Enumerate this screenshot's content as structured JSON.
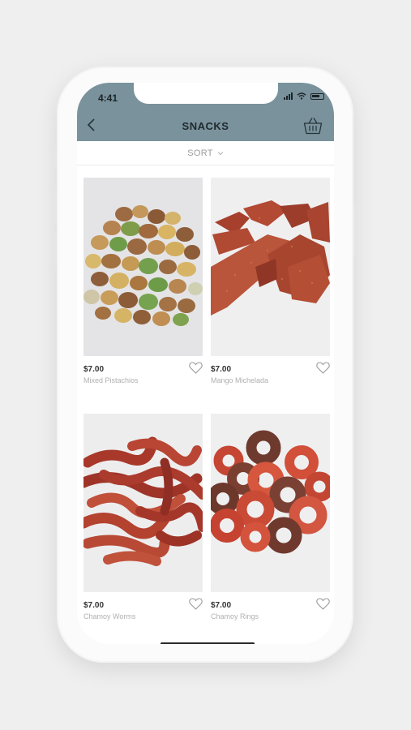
{
  "status_bar": {
    "time": "4:41"
  },
  "header": {
    "title": "SNACKS",
    "back_icon": "chevron-left-icon",
    "cart_icon": "basket-icon",
    "background": "#7a929c"
  },
  "sort": {
    "label": "SORT"
  },
  "products": [
    {
      "price": "$7.00",
      "name": "Mixed Pistachios",
      "image": "pistachios-image"
    },
    {
      "price": "$7.00",
      "name": "Mango Michelada",
      "image": "mango-michelada-image"
    },
    {
      "price": "$7.00",
      "name": "Chamoy Worms",
      "image": "chamoy-worms-image"
    },
    {
      "price": "$7.00",
      "name": "Chamoy Rings",
      "image": "chamoy-rings-image"
    }
  ]
}
